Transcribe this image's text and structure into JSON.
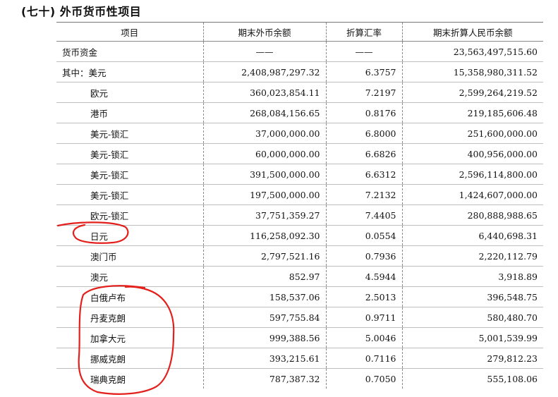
{
  "title": "(七十)  外币货币性项目",
  "headers": [
    "项目",
    "期末外币余额",
    "折算汇率",
    "期末折算人民币余额"
  ],
  "rows": [
    {
      "item": "货币资金",
      "foreign": "——",
      "rate": "——",
      "rmb": "23,563,497,515.60"
    },
    {
      "item": "其中：美元",
      "foreign": "2,408,987,297.32",
      "rate": "6.3757",
      "rmb": "15,358,980,311.52"
    },
    {
      "item": "欧元",
      "foreign": "360,023,854.11",
      "rate": "7.2197",
      "rmb": "2,599,264,219.52"
    },
    {
      "item": "港币",
      "foreign": "268,084,156.65",
      "rate": "0.8176",
      "rmb": "219,185,606.48"
    },
    {
      "item": "美元-锁汇",
      "foreign": "37,000,000.00",
      "rate": "6.8000",
      "rmb": "251,600,000.00"
    },
    {
      "item": "美元-锁汇",
      "foreign": "60,000,000.00",
      "rate": "6.6826",
      "rmb": "400,956,000.00"
    },
    {
      "item": "美元-锁汇",
      "foreign": "391,500,000.00",
      "rate": "6.6312",
      "rmb": "2,596,114,800.00"
    },
    {
      "item": "美元-锁汇",
      "foreign": "197,500,000.00",
      "rate": "7.2132",
      "rmb": "1,424,607,000.00"
    },
    {
      "item": "欧元-锁汇",
      "foreign": "37,751,359.27",
      "rate": "7.4405",
      "rmb": "280,888,988.65"
    },
    {
      "item": "日元",
      "foreign": "116,258,092.30",
      "rate": "0.0554",
      "rmb": "6,440,698.31"
    },
    {
      "item": "澳门币",
      "foreign": "2,797,521.16",
      "rate": "0.7936",
      "rmb": "2,220,112.79"
    },
    {
      "item": "澳元",
      "foreign": "852.97",
      "rate": "4.5944",
      "rmb": "3,918.89"
    },
    {
      "item": "白俄卢布",
      "foreign": "158,537.06",
      "rate": "2.5013",
      "rmb": "396,548.75"
    },
    {
      "item": "丹麦克朗",
      "foreign": "597,755.84",
      "rate": "0.9711",
      "rmb": "580,480.70"
    },
    {
      "item": "加拿大元",
      "foreign": "999,388.56",
      "rate": "5.0046",
      "rmb": "5,001,539.99"
    },
    {
      "item": "挪威克朗",
      "foreign": "393,215.61",
      "rate": "0.7116",
      "rmb": "279,812.23"
    },
    {
      "item": "瑞典克朗",
      "foreign": "787,387.32",
      "rate": "0.7050",
      "rmb": "555,108.06"
    }
  ],
  "annotation_color": "#e3201b"
}
